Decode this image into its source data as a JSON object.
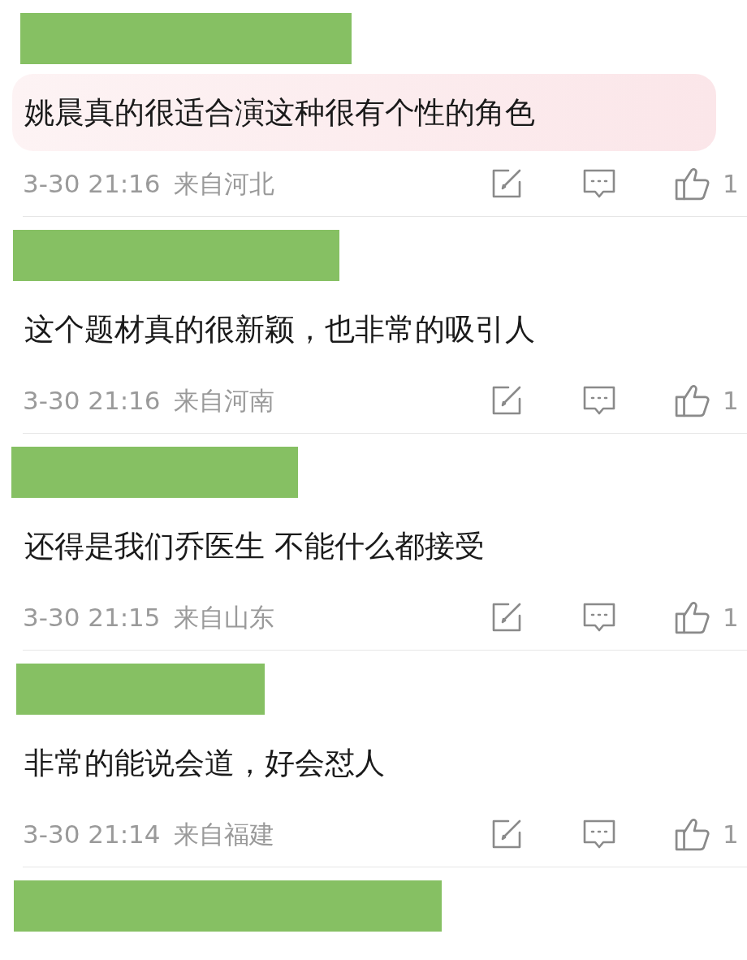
{
  "comments": [
    {
      "kind": "comment",
      "highlighted": true,
      "text": "姚晨真的很适合演这种很有个性的角色",
      "time": "3-30 21:16",
      "location": "来自河北",
      "likes": "1"
    },
    {
      "kind": "comment",
      "highlighted": false,
      "text": "这个题材真的很新颖，也非常的吸引人",
      "time": "3-30 21:16",
      "location": "来自河南",
      "likes": "1"
    },
    {
      "kind": "comment",
      "highlighted": false,
      "text": "还得是我们乔医生  不能什么都接受",
      "time": "3-30 21:15",
      "location": "来自山东",
      "likes": "1"
    },
    {
      "kind": "comment",
      "highlighted": false,
      "text": "非常的能说会道，好会怼人",
      "time": "3-30 21:14",
      "location": "来自福建",
      "likes": "1"
    },
    {
      "kind": "cut"
    }
  ]
}
